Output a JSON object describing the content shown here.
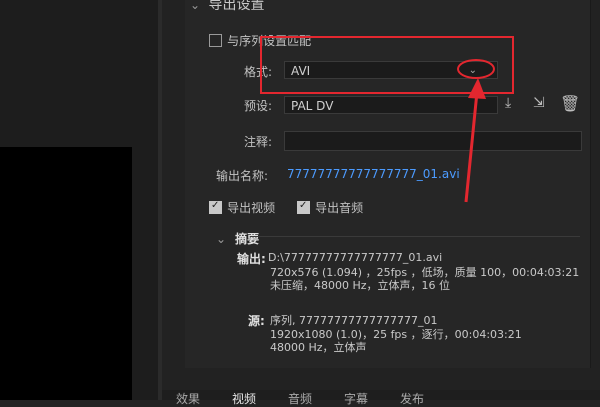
{
  "export_settings": {
    "section_title": "导出设置",
    "match_sequence_label": "与序列设置匹配",
    "format_label": "格式:",
    "format_value": "AVI",
    "preset_label": "预设:",
    "preset_value": "PAL DV",
    "comment_label": "注释:",
    "comment_value": "",
    "output_name_label": "输出名称:",
    "output_name_value": "77777777777777777_01.avi",
    "export_video_label": "导出视频",
    "export_audio_label": "导出音频"
  },
  "summary": {
    "title": "摘要",
    "output_label": "输出:",
    "output_path": "D:\\77777777777777777_01.avi",
    "output_line2": "720x576 (1.094) ，25fps ，低场，质量 100，00:04:03:21",
    "output_line3": "未压缩，48000 Hz，立体声，16 位",
    "source_label": "源:",
    "source_line1": "序列, 77777777777777777_01",
    "source_line2": "1920x1080 (1.0)，25 fps ，逐行，00:04:03:21",
    "source_line3": "48000 Hz，立体声"
  },
  "tabs": [
    "效果",
    "视频",
    "音频",
    "字幕",
    "发布"
  ],
  "annotation_colors": {
    "highlight": "#e3272f"
  }
}
